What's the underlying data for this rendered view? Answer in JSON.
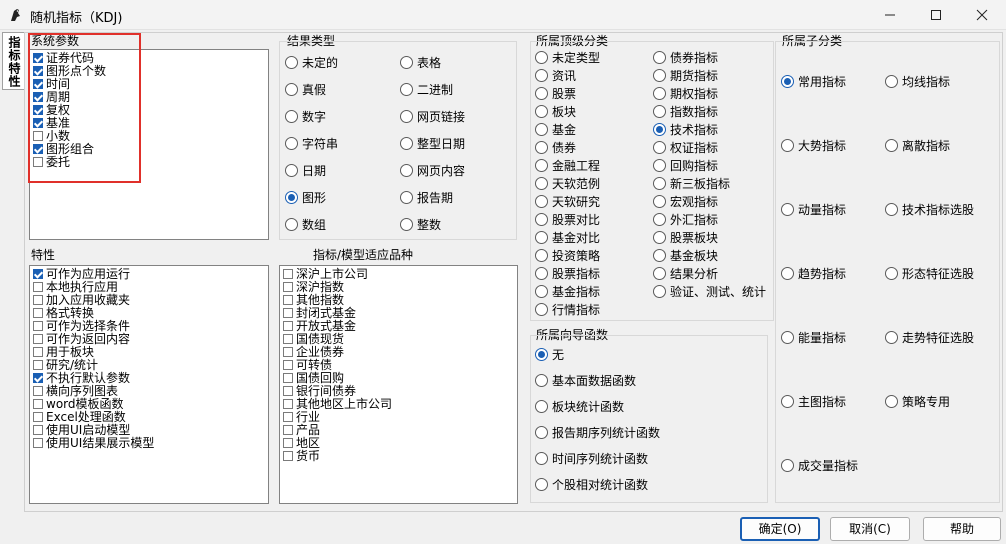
{
  "window": {
    "title": "随机指标（KDJ)",
    "app_icon": "bird-app-icon",
    "controls": [
      "minimize-icon",
      "maximize-icon",
      "close-icon"
    ]
  },
  "vertical_tab": {
    "label": "指标特性"
  },
  "system_params": {
    "label": "系统参数",
    "items": [
      {
        "label": "证券代码",
        "checked": true
      },
      {
        "label": "图形点个数",
        "checked": true
      },
      {
        "label": "时间",
        "checked": true
      },
      {
        "label": "周期",
        "checked": true
      },
      {
        "label": "复权",
        "checked": true
      },
      {
        "label": "基准",
        "checked": true
      },
      {
        "label": "小数",
        "checked": false
      },
      {
        "label": "图形组合",
        "checked": true
      },
      {
        "label": "委托",
        "checked": false
      }
    ]
  },
  "result_type": {
    "label": "结果类型",
    "col1": [
      {
        "label": "未定的",
        "selected": false
      },
      {
        "label": "真假",
        "selected": false
      },
      {
        "label": "数字",
        "selected": false
      },
      {
        "label": "字符串",
        "selected": false
      },
      {
        "label": "日期",
        "selected": false
      },
      {
        "label": "图形",
        "selected": true
      },
      {
        "label": "数组",
        "selected": false
      }
    ],
    "col2": [
      {
        "label": "表格",
        "selected": false
      },
      {
        "label": "二进制",
        "selected": false
      },
      {
        "label": "网页链接",
        "selected": false
      },
      {
        "label": "整型日期",
        "selected": false
      },
      {
        "label": "网页内容",
        "selected": false
      },
      {
        "label": "报告期",
        "selected": false
      },
      {
        "label": "整数",
        "selected": false
      }
    ]
  },
  "features": {
    "label": "特性",
    "items": [
      {
        "label": "可作为应用运行",
        "checked": true
      },
      {
        "label": "本地执行应用",
        "checked": false
      },
      {
        "label": "加入应用收藏夹",
        "checked": false
      },
      {
        "label": "格式转换",
        "checked": false
      },
      {
        "label": "可作为选择条件",
        "checked": false
      },
      {
        "label": "可作为返回内容",
        "checked": false
      },
      {
        "label": "用于板块",
        "checked": false
      },
      {
        "label": "研究/统计",
        "checked": false
      },
      {
        "label": "不执行默认参数",
        "checked": true
      },
      {
        "label": "横向序列图表",
        "checked": false
      },
      {
        "label": "word模板函数",
        "checked": false
      },
      {
        "label": "Excel处理函数",
        "checked": false
      },
      {
        "label": "使用UI启动模型",
        "checked": false
      },
      {
        "label": "使用UI结果展示模型",
        "checked": false
      }
    ]
  },
  "applicable": {
    "label": "指标/模型适应品种",
    "items": [
      {
        "label": "深沪上市公司",
        "checked": false
      },
      {
        "label": "深沪指数",
        "checked": false
      },
      {
        "label": "其他指数",
        "checked": false
      },
      {
        "label": "封闭式基金",
        "checked": false
      },
      {
        "label": "开放式基金",
        "checked": false
      },
      {
        "label": "国债现货",
        "checked": false
      },
      {
        "label": "企业债券",
        "checked": false
      },
      {
        "label": "可转债",
        "checked": false
      },
      {
        "label": "国债回购",
        "checked": false
      },
      {
        "label": "银行间债券",
        "checked": false
      },
      {
        "label": "其他地区上市公司",
        "checked": false
      },
      {
        "label": "行业",
        "checked": false
      },
      {
        "label": "产品",
        "checked": false
      },
      {
        "label": "地区",
        "checked": false
      },
      {
        "label": "货币",
        "checked": false
      }
    ]
  },
  "top_category": {
    "label": "所属顶级分类",
    "col1": [
      {
        "label": "未定类型",
        "selected": false
      },
      {
        "label": "资讯",
        "selected": false
      },
      {
        "label": "股票",
        "selected": false
      },
      {
        "label": "板块",
        "selected": false
      },
      {
        "label": "基金",
        "selected": false
      },
      {
        "label": "债券",
        "selected": false
      },
      {
        "label": "金融工程",
        "selected": false
      },
      {
        "label": "天软范例",
        "selected": false
      },
      {
        "label": "天软研究",
        "selected": false
      },
      {
        "label": "股票对比",
        "selected": false
      },
      {
        "label": "基金对比",
        "selected": false
      },
      {
        "label": "投资策略",
        "selected": false
      },
      {
        "label": "股票指标",
        "selected": false
      },
      {
        "label": "基金指标",
        "selected": false
      },
      {
        "label": "行情指标",
        "selected": false
      }
    ],
    "col2": [
      {
        "label": "债券指标",
        "selected": false
      },
      {
        "label": "期货指标",
        "selected": false
      },
      {
        "label": "期权指标",
        "selected": false
      },
      {
        "label": "指数指标",
        "selected": false
      },
      {
        "label": "技术指标",
        "selected": true
      },
      {
        "label": "权证指标",
        "selected": false
      },
      {
        "label": "回购指标",
        "selected": false
      },
      {
        "label": "新三板指标",
        "selected": false
      },
      {
        "label": "宏观指标",
        "selected": false
      },
      {
        "label": "外汇指标",
        "selected": false
      },
      {
        "label": "股票板块",
        "selected": false
      },
      {
        "label": "基金板块",
        "selected": false
      },
      {
        "label": "结果分析",
        "selected": false
      },
      {
        "label": "验证、测试、统计",
        "selected": false
      }
    ]
  },
  "guide_function": {
    "label": "所属向导函数",
    "items": [
      {
        "label": "无",
        "selected": true
      },
      {
        "label": "基本面数据函数",
        "selected": false
      },
      {
        "label": "板块统计函数",
        "selected": false
      },
      {
        "label": "报告期序列统计函数",
        "selected": false
      },
      {
        "label": "时间序列统计函数",
        "selected": false
      },
      {
        "label": "个股相对统计函数",
        "selected": false
      }
    ]
  },
  "sub_category": {
    "label": "所属子分类",
    "col1": [
      {
        "label": "常用指标",
        "selected": true
      },
      {
        "label": "大势指标",
        "selected": false
      },
      {
        "label": "动量指标",
        "selected": false
      },
      {
        "label": "趋势指标",
        "selected": false
      },
      {
        "label": "能量指标",
        "selected": false
      },
      {
        "label": "主图指标",
        "selected": false
      },
      {
        "label": "成交量指标",
        "selected": false
      }
    ],
    "col2": [
      {
        "label": "均线指标",
        "selected": false
      },
      {
        "label": "离散指标",
        "selected": false
      },
      {
        "label": "技术指标选股",
        "selected": false
      },
      {
        "label": "形态特征选股",
        "selected": false
      },
      {
        "label": "走势特征选股",
        "selected": false
      },
      {
        "label": "策略专用",
        "selected": false
      }
    ]
  },
  "buttons": {
    "ok": "确定(O)",
    "cancel": "取消(C)",
    "help": "帮助"
  },
  "colors": {
    "accent": "#1a5fb4",
    "highlight": "#e0302a"
  }
}
